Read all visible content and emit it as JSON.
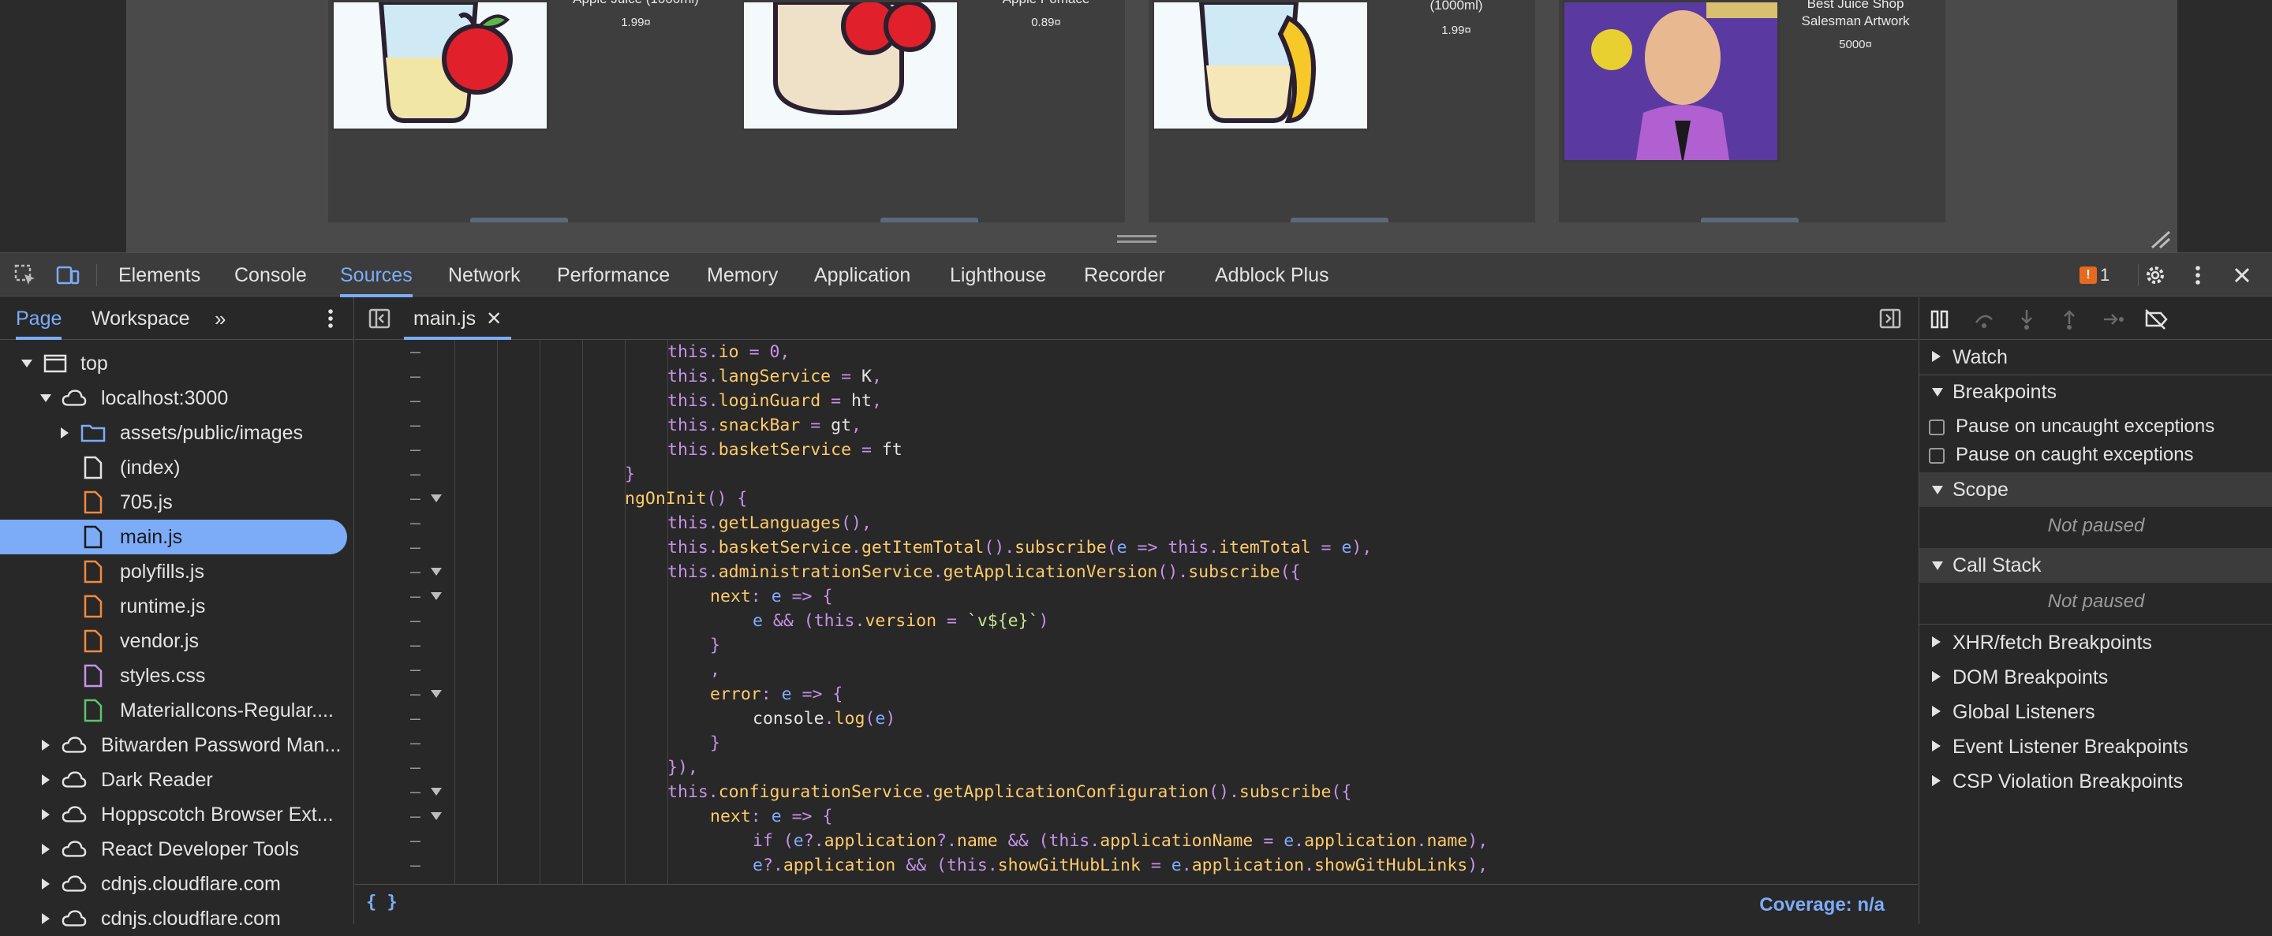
{
  "preview": {
    "cards": [
      {
        "name": "Apple Juice (1000ml)",
        "price": "1.99¤"
      },
      {
        "name": "Apple Pomace",
        "price": "0.89¤"
      },
      {
        "name": "(1000ml)",
        "price": "1.99¤"
      },
      {
        "name": "Best Juice Shop Salesman Artwork",
        "price": "5000¤"
      }
    ]
  },
  "devtools": {
    "tabs": [
      "Elements",
      "Console",
      "Sources",
      "Network",
      "Performance",
      "Memory",
      "Application",
      "Lighthouse",
      "Recorder",
      "Adblock Plus"
    ],
    "active_tab": "Sources",
    "issues_count": "1"
  },
  "navigator": {
    "tabs": [
      "Page",
      "Workspace"
    ],
    "tree": [
      {
        "label": "top"
      },
      {
        "label": "localhost:3000"
      },
      {
        "label": "assets/public/images"
      },
      {
        "label": "(index)"
      },
      {
        "label": "705.js"
      },
      {
        "label": "main.js"
      },
      {
        "label": "polyfills.js"
      },
      {
        "label": "runtime.js"
      },
      {
        "label": "vendor.js"
      },
      {
        "label": "styles.css"
      },
      {
        "label": "MaterialIcons-Regular...."
      },
      {
        "label": "Bitwarden Password Man..."
      },
      {
        "label": "Dark Reader"
      },
      {
        "label": "Hoppscotch Browser Ext..."
      },
      {
        "label": "React Developer Tools"
      },
      {
        "label": "cdnjs.cloudflare.com"
      },
      {
        "label": "cdnjs.cloudflare.com"
      }
    ]
  },
  "editor": {
    "file_tab": "main.js",
    "status": {
      "format": "{ }",
      "coverage": "Coverage: n/a"
    }
  },
  "debugger": {
    "sections": {
      "watch": "Watch",
      "breakpoints": "Breakpoints",
      "pause_uncaught": "Pause on uncaught exceptions",
      "pause_caught": "Pause on caught exceptions",
      "scope": "Scope",
      "scope_status": "Not paused",
      "call_stack": "Call Stack",
      "call_stack_status": "Not paused",
      "xhr": "XHR/fetch Breakpoints",
      "dom": "DOM Breakpoints",
      "global": "Global Listeners",
      "event": "Event Listener Breakpoints",
      "csp": "CSP Violation Breakpoints"
    }
  },
  "code_lines": [
    "this.io = 0,",
    "this.langService = K,",
    "this.loginGuard = ht,",
    "this.snackBar = gt,",
    "this.basketService = ft",
    "}",
    "ngOnInit() {",
    "this.getLanguages(),",
    "this.basketService.getItemTotal().subscribe(e => this.itemTotal = e),",
    "this.administrationService.getApplicationVersion().subscribe({",
    "next: e => {",
    "e && (this.version = `v${e}`)",
    "}",
    ",",
    "error: e => {",
    "console.log(e)",
    "}",
    "}),",
    "this.configurationService.getApplicationConfiguration().subscribe({",
    "next: e => {",
    "if (e?.application?.name && (this.applicationName = e.application.name),",
    "e?.application && (this.showGitHubLink = e.application.showGitHubLinks),"
  ]
}
